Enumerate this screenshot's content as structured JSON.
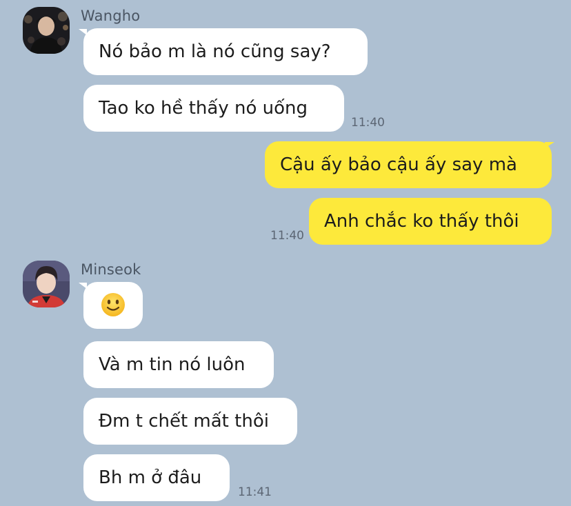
{
  "chat": {
    "groups": [
      {
        "sender": "Wangho",
        "avatar": "user-avatar-photo",
        "messages": [
          {
            "text": "Nó bảo m là nó cũng say?"
          },
          {
            "text": "Tao ko hề thấy nó uống",
            "time": "11:40"
          }
        ]
      },
      {
        "sender": "me",
        "messages": [
          {
            "text": "Cậu ấy bảo cậu ấy say mà"
          },
          {
            "text": "Anh chắc ko thấy thôi",
            "time": "11:40"
          }
        ]
      },
      {
        "sender": "Minseok",
        "avatar": "user-avatar-photo",
        "messages": [
          {
            "emoji": "slightly-smiling-face-emoji"
          },
          {
            "text": "Và m tin nó luôn"
          },
          {
            "text": "Đm t chết mất thôi"
          },
          {
            "text": "Bh m ở đâu",
            "time": "11:41"
          }
        ]
      }
    ]
  },
  "colors": {
    "background": "#aec0d2",
    "incoming_bubble": "#ffffff",
    "outgoing_bubble": "#fde93b",
    "timestamp": "#5b6573"
  }
}
